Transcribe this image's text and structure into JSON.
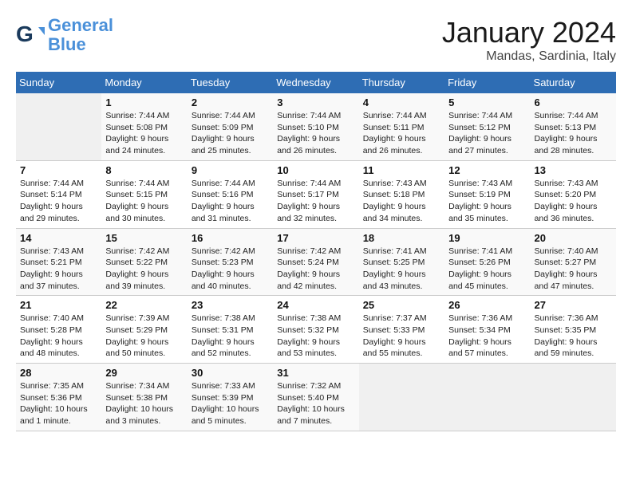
{
  "header": {
    "logo_line1": "General",
    "logo_line2": "Blue",
    "month": "January 2024",
    "location": "Mandas, Sardinia, Italy"
  },
  "weekdays": [
    "Sunday",
    "Monday",
    "Tuesday",
    "Wednesday",
    "Thursday",
    "Friday",
    "Saturday"
  ],
  "weeks": [
    [
      {
        "day": "",
        "sunrise": "",
        "sunset": "",
        "daylight": ""
      },
      {
        "day": "1",
        "sunrise": "Sunrise: 7:44 AM",
        "sunset": "Sunset: 5:08 PM",
        "daylight": "Daylight: 9 hours and 24 minutes."
      },
      {
        "day": "2",
        "sunrise": "Sunrise: 7:44 AM",
        "sunset": "Sunset: 5:09 PM",
        "daylight": "Daylight: 9 hours and 25 minutes."
      },
      {
        "day": "3",
        "sunrise": "Sunrise: 7:44 AM",
        "sunset": "Sunset: 5:10 PM",
        "daylight": "Daylight: 9 hours and 26 minutes."
      },
      {
        "day": "4",
        "sunrise": "Sunrise: 7:44 AM",
        "sunset": "Sunset: 5:11 PM",
        "daylight": "Daylight: 9 hours and 26 minutes."
      },
      {
        "day": "5",
        "sunrise": "Sunrise: 7:44 AM",
        "sunset": "Sunset: 5:12 PM",
        "daylight": "Daylight: 9 hours and 27 minutes."
      },
      {
        "day": "6",
        "sunrise": "Sunrise: 7:44 AM",
        "sunset": "Sunset: 5:13 PM",
        "daylight": "Daylight: 9 hours and 28 minutes."
      }
    ],
    [
      {
        "day": "7",
        "sunrise": "Sunrise: 7:44 AM",
        "sunset": "Sunset: 5:14 PM",
        "daylight": "Daylight: 9 hours and 29 minutes."
      },
      {
        "day": "8",
        "sunrise": "Sunrise: 7:44 AM",
        "sunset": "Sunset: 5:15 PM",
        "daylight": "Daylight: 9 hours and 30 minutes."
      },
      {
        "day": "9",
        "sunrise": "Sunrise: 7:44 AM",
        "sunset": "Sunset: 5:16 PM",
        "daylight": "Daylight: 9 hours and 31 minutes."
      },
      {
        "day": "10",
        "sunrise": "Sunrise: 7:44 AM",
        "sunset": "Sunset: 5:17 PM",
        "daylight": "Daylight: 9 hours and 32 minutes."
      },
      {
        "day": "11",
        "sunrise": "Sunrise: 7:43 AM",
        "sunset": "Sunset: 5:18 PM",
        "daylight": "Daylight: 9 hours and 34 minutes."
      },
      {
        "day": "12",
        "sunrise": "Sunrise: 7:43 AM",
        "sunset": "Sunset: 5:19 PM",
        "daylight": "Daylight: 9 hours and 35 minutes."
      },
      {
        "day": "13",
        "sunrise": "Sunrise: 7:43 AM",
        "sunset": "Sunset: 5:20 PM",
        "daylight": "Daylight: 9 hours and 36 minutes."
      }
    ],
    [
      {
        "day": "14",
        "sunrise": "Sunrise: 7:43 AM",
        "sunset": "Sunset: 5:21 PM",
        "daylight": "Daylight: 9 hours and 37 minutes."
      },
      {
        "day": "15",
        "sunrise": "Sunrise: 7:42 AM",
        "sunset": "Sunset: 5:22 PM",
        "daylight": "Daylight: 9 hours and 39 minutes."
      },
      {
        "day": "16",
        "sunrise": "Sunrise: 7:42 AM",
        "sunset": "Sunset: 5:23 PM",
        "daylight": "Daylight: 9 hours and 40 minutes."
      },
      {
        "day": "17",
        "sunrise": "Sunrise: 7:42 AM",
        "sunset": "Sunset: 5:24 PM",
        "daylight": "Daylight: 9 hours and 42 minutes."
      },
      {
        "day": "18",
        "sunrise": "Sunrise: 7:41 AM",
        "sunset": "Sunset: 5:25 PM",
        "daylight": "Daylight: 9 hours and 43 minutes."
      },
      {
        "day": "19",
        "sunrise": "Sunrise: 7:41 AM",
        "sunset": "Sunset: 5:26 PM",
        "daylight": "Daylight: 9 hours and 45 minutes."
      },
      {
        "day": "20",
        "sunrise": "Sunrise: 7:40 AM",
        "sunset": "Sunset: 5:27 PM",
        "daylight": "Daylight: 9 hours and 47 minutes."
      }
    ],
    [
      {
        "day": "21",
        "sunrise": "Sunrise: 7:40 AM",
        "sunset": "Sunset: 5:28 PM",
        "daylight": "Daylight: 9 hours and 48 minutes."
      },
      {
        "day": "22",
        "sunrise": "Sunrise: 7:39 AM",
        "sunset": "Sunset: 5:29 PM",
        "daylight": "Daylight: 9 hours and 50 minutes."
      },
      {
        "day": "23",
        "sunrise": "Sunrise: 7:38 AM",
        "sunset": "Sunset: 5:31 PM",
        "daylight": "Daylight: 9 hours and 52 minutes."
      },
      {
        "day": "24",
        "sunrise": "Sunrise: 7:38 AM",
        "sunset": "Sunset: 5:32 PM",
        "daylight": "Daylight: 9 hours and 53 minutes."
      },
      {
        "day": "25",
        "sunrise": "Sunrise: 7:37 AM",
        "sunset": "Sunset: 5:33 PM",
        "daylight": "Daylight: 9 hours and 55 minutes."
      },
      {
        "day": "26",
        "sunrise": "Sunrise: 7:36 AM",
        "sunset": "Sunset: 5:34 PM",
        "daylight": "Daylight: 9 hours and 57 minutes."
      },
      {
        "day": "27",
        "sunrise": "Sunrise: 7:36 AM",
        "sunset": "Sunset: 5:35 PM",
        "daylight": "Daylight: 9 hours and 59 minutes."
      }
    ],
    [
      {
        "day": "28",
        "sunrise": "Sunrise: 7:35 AM",
        "sunset": "Sunset: 5:36 PM",
        "daylight": "Daylight: 10 hours and 1 minute."
      },
      {
        "day": "29",
        "sunrise": "Sunrise: 7:34 AM",
        "sunset": "Sunset: 5:38 PM",
        "daylight": "Daylight: 10 hours and 3 minutes."
      },
      {
        "day": "30",
        "sunrise": "Sunrise: 7:33 AM",
        "sunset": "Sunset: 5:39 PM",
        "daylight": "Daylight: 10 hours and 5 minutes."
      },
      {
        "day": "31",
        "sunrise": "Sunrise: 7:32 AM",
        "sunset": "Sunset: 5:40 PM",
        "daylight": "Daylight: 10 hours and 7 minutes."
      },
      {
        "day": "",
        "sunrise": "",
        "sunset": "",
        "daylight": ""
      },
      {
        "day": "",
        "sunrise": "",
        "sunset": "",
        "daylight": ""
      },
      {
        "day": "",
        "sunrise": "",
        "sunset": "",
        "daylight": ""
      }
    ]
  ]
}
